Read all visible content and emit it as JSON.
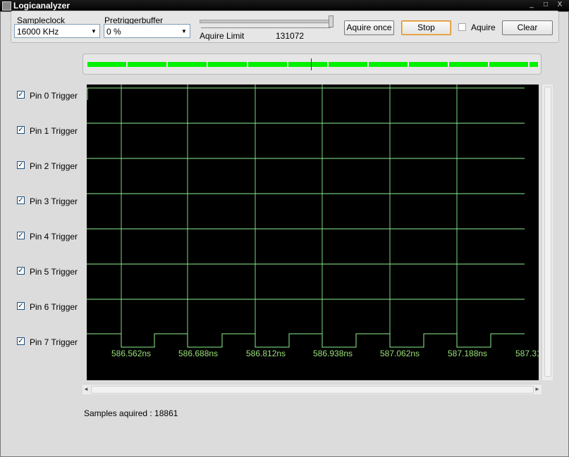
{
  "window": {
    "title": "Logicanalyzer",
    "controls": [
      "_",
      "□",
      "X"
    ]
  },
  "toolbar": {
    "sampleclock_label": "Sampleclock",
    "sampleclock_value": "16000 KHz",
    "pretrigger_label": "Pretriggerbuffer",
    "pretrigger_value": "0 %",
    "aquire_limit_label": "Aquire Limit",
    "aquire_limit_value": "131072",
    "aquire_once_label": "Aquire once",
    "stop_label": "Stop",
    "aquire_label": "Aquire",
    "aquire_checked": false,
    "clear_label": "Clear"
  },
  "pins": [
    {
      "label": "Pin 0 Trigger",
      "checked": true
    },
    {
      "label": "Pin 1 Trigger",
      "checked": true
    },
    {
      "label": "Pin 2 Trigger",
      "checked": true
    },
    {
      "label": "Pin 3 Trigger",
      "checked": true
    },
    {
      "label": "Pin 4 Trigger",
      "checked": true
    },
    {
      "label": "Pin 5 Trigger",
      "checked": true
    },
    {
      "label": "Pin 6 Trigger",
      "checked": true
    },
    {
      "label": "Pin 7 Trigger",
      "checked": true
    }
  ],
  "scope": {
    "time_labels": [
      "586.562ns",
      "586.688ns",
      "586.812ns",
      "586.938ns",
      "587.062ns",
      "587.188ns",
      "587.31"
    ],
    "pin7_levels": [
      1,
      0,
      1,
      0,
      1,
      0,
      1,
      0,
      1,
      0,
      1,
      0,
      1
    ],
    "channel_count": 8,
    "colors": {
      "background": "#000000",
      "signal": "#8cf08c",
      "gridline": "#7ad87a",
      "time_label": "#9be07a"
    }
  },
  "status": {
    "samples_label": "Samples aquired : 18861"
  }
}
